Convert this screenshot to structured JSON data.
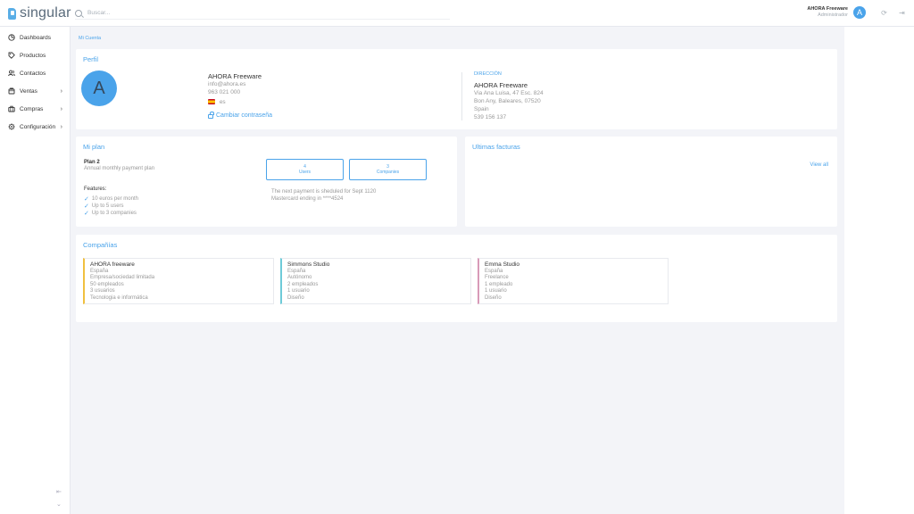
{
  "app": {
    "logo_text": "singular"
  },
  "search": {
    "placeholder": "Buscar..."
  },
  "user": {
    "name": "AHORA Freeware",
    "role": "Administrador",
    "avatar_letter": "A"
  },
  "sidebar": {
    "items": [
      {
        "label": "Dashboards",
        "icon": "dashboard-icon",
        "has_submenu": false
      },
      {
        "label": "Productos",
        "icon": "tag-icon",
        "has_submenu": false
      },
      {
        "label": "Contactos",
        "icon": "users-icon",
        "has_submenu": false
      },
      {
        "label": "Ventas",
        "icon": "cart-icon",
        "has_submenu": true
      },
      {
        "label": "Compras",
        "icon": "briefcase-icon",
        "has_submenu": true
      },
      {
        "label": "Configuración",
        "icon": "gear-icon",
        "has_submenu": true
      }
    ]
  },
  "breadcrumb": "Mi Cuenta",
  "profile": {
    "title": "Perfil",
    "avatar_letter": "A",
    "name": "AHORA Freeware",
    "email": "info@ahora.es",
    "phone": "963 021 000",
    "language": "es",
    "change_password": "Cambiar contraseña",
    "address_label": "DIRECCIÓN",
    "address_name": "AHORA Freeware",
    "address_street": "Via Ana Luisa, 47 Esc. 824",
    "address_city": "Bon Any, Baleares, 07520",
    "address_country": "Spain",
    "address_phone": "539 156 137"
  },
  "plan": {
    "title": "Mi plan",
    "name": "Plan 2",
    "description": "Annual monthly payment plan",
    "users_count": "4",
    "users_label": "Users",
    "companies_count": "3",
    "companies_label": "Companies",
    "features_label": "Features:",
    "features": [
      "10 euros per month",
      "Up to 5 users",
      "Up to 3 companies"
    ],
    "next_payment": "The next payment is sheduled for Sept 1120",
    "card_info": "Mastercard ending in ****4524"
  },
  "invoices": {
    "title": "Ultimas facturas",
    "view_all": "View all"
  },
  "companies": {
    "title": "Compañías",
    "items": [
      {
        "name": "AHORA freeware",
        "country": "España",
        "type": "Empresa/sociedad limitada",
        "employees": "50 empleados",
        "users": "3 usuarios",
        "sector": "Tecnologia e informática",
        "color": "#f0c040"
      },
      {
        "name": "Simmons Studio",
        "country": "España",
        "type": "Autónomo",
        "employees": "2 empleados",
        "users": "1 usuario",
        "sector": "Diseño",
        "color": "#6ecbd8"
      },
      {
        "name": "Emma Studio",
        "country": "España",
        "type": "Freelance",
        "employees": "1 empleado",
        "users": "1 usuario",
        "sector": "Diseño",
        "color": "#d89ab8"
      }
    ]
  },
  "colors": {
    "accent": "#4aa3ea",
    "background": "#f3f4f8"
  }
}
